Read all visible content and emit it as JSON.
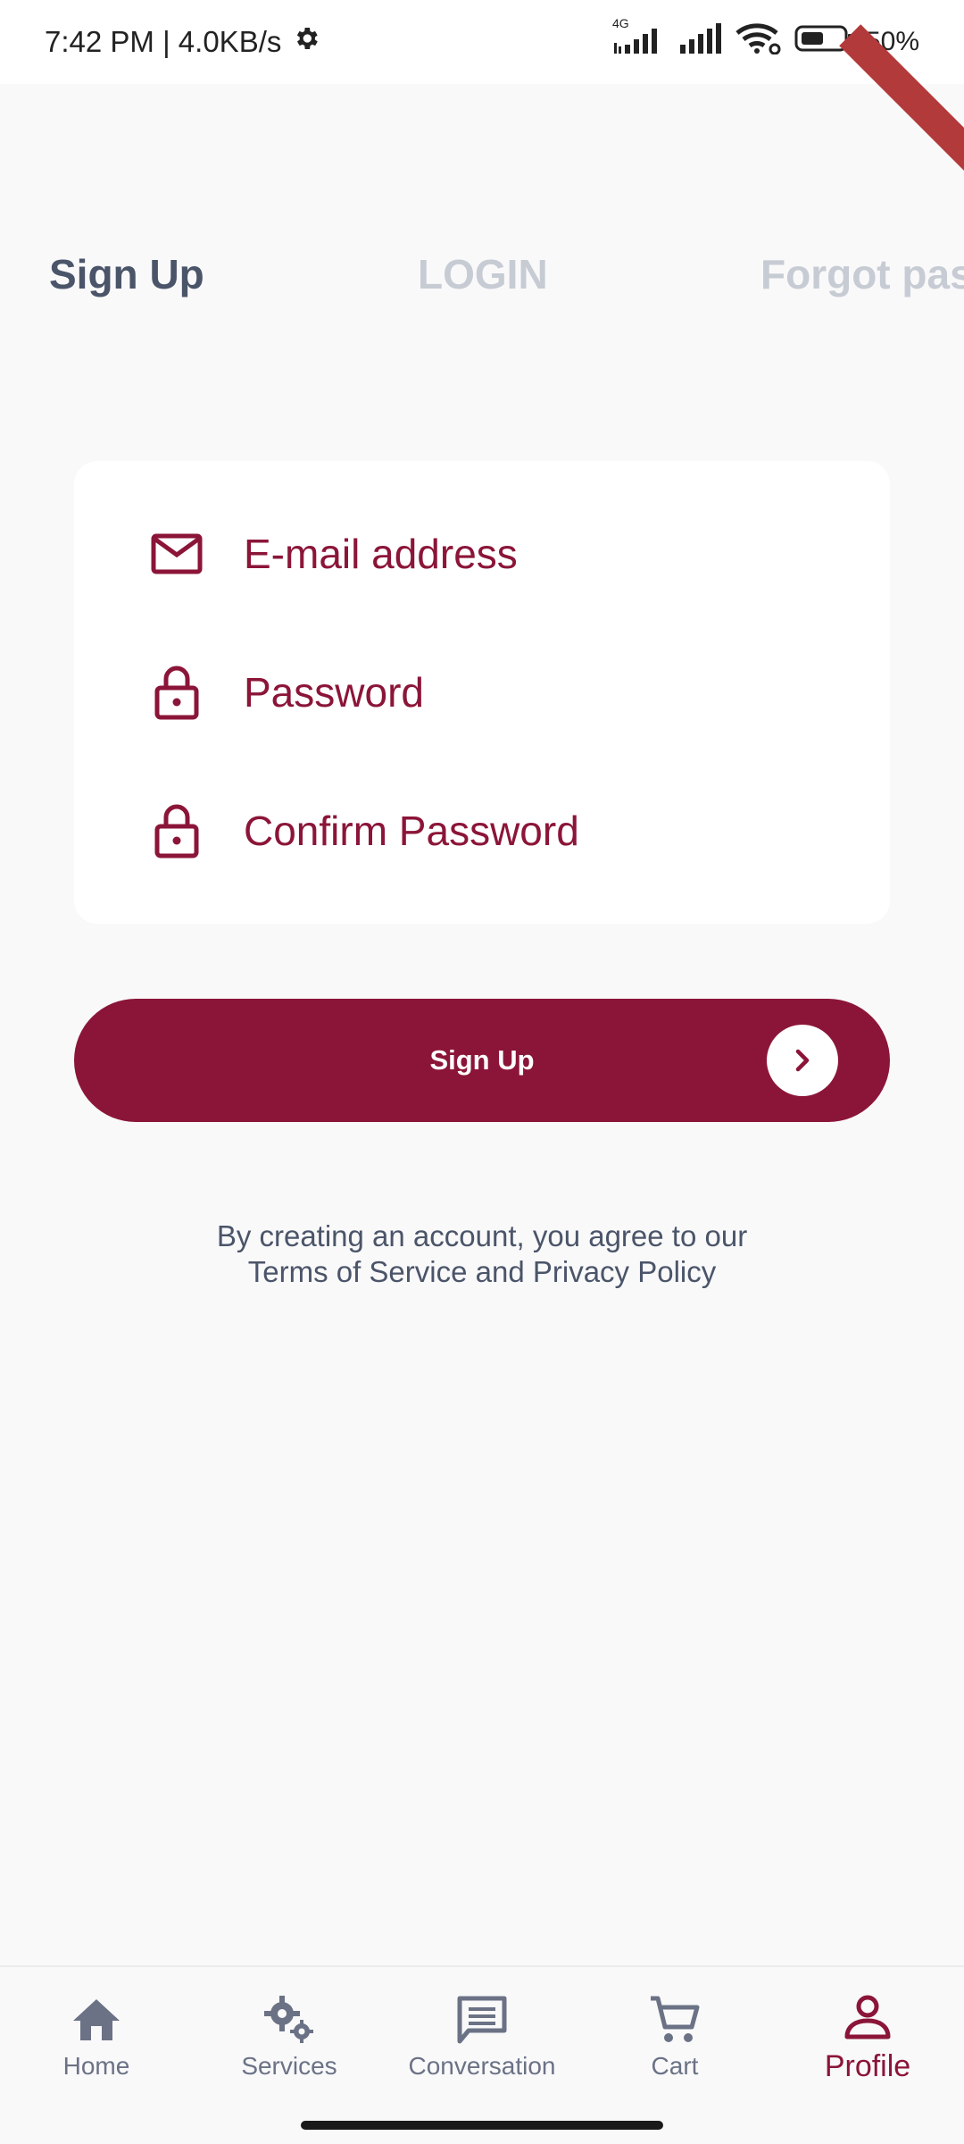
{
  "status_bar": {
    "time_speed": "7:42 PM | 4.0KB/s",
    "network_label": "4G",
    "battery": "50%"
  },
  "tabs": [
    "Sign Up",
    "LOGIN",
    "Forgot pas"
  ],
  "form": {
    "email_placeholder": "E-mail address",
    "password_placeholder": "Password",
    "confirm_placeholder": "Confirm Password"
  },
  "signup_button": {
    "label": "Sign Up"
  },
  "terms": {
    "line1": "By creating an account, you agree to our",
    "line2": "Terms of Service and Privacy Policy"
  },
  "bottom_nav": [
    {
      "label": "Home",
      "icon": "home-icon"
    },
    {
      "label": "Services",
      "icon": "gears-icon"
    },
    {
      "label": "Conversation",
      "icon": "chat-icon"
    },
    {
      "label": "Cart",
      "icon": "cart-icon"
    },
    {
      "label": "Profile",
      "icon": "person-icon",
      "active": true
    }
  ],
  "colors": {
    "accent": "#8b1538",
    "tab_active": "#4b5569",
    "tab_inactive": "#c7cbd3",
    "background": "#f9f9fa"
  }
}
